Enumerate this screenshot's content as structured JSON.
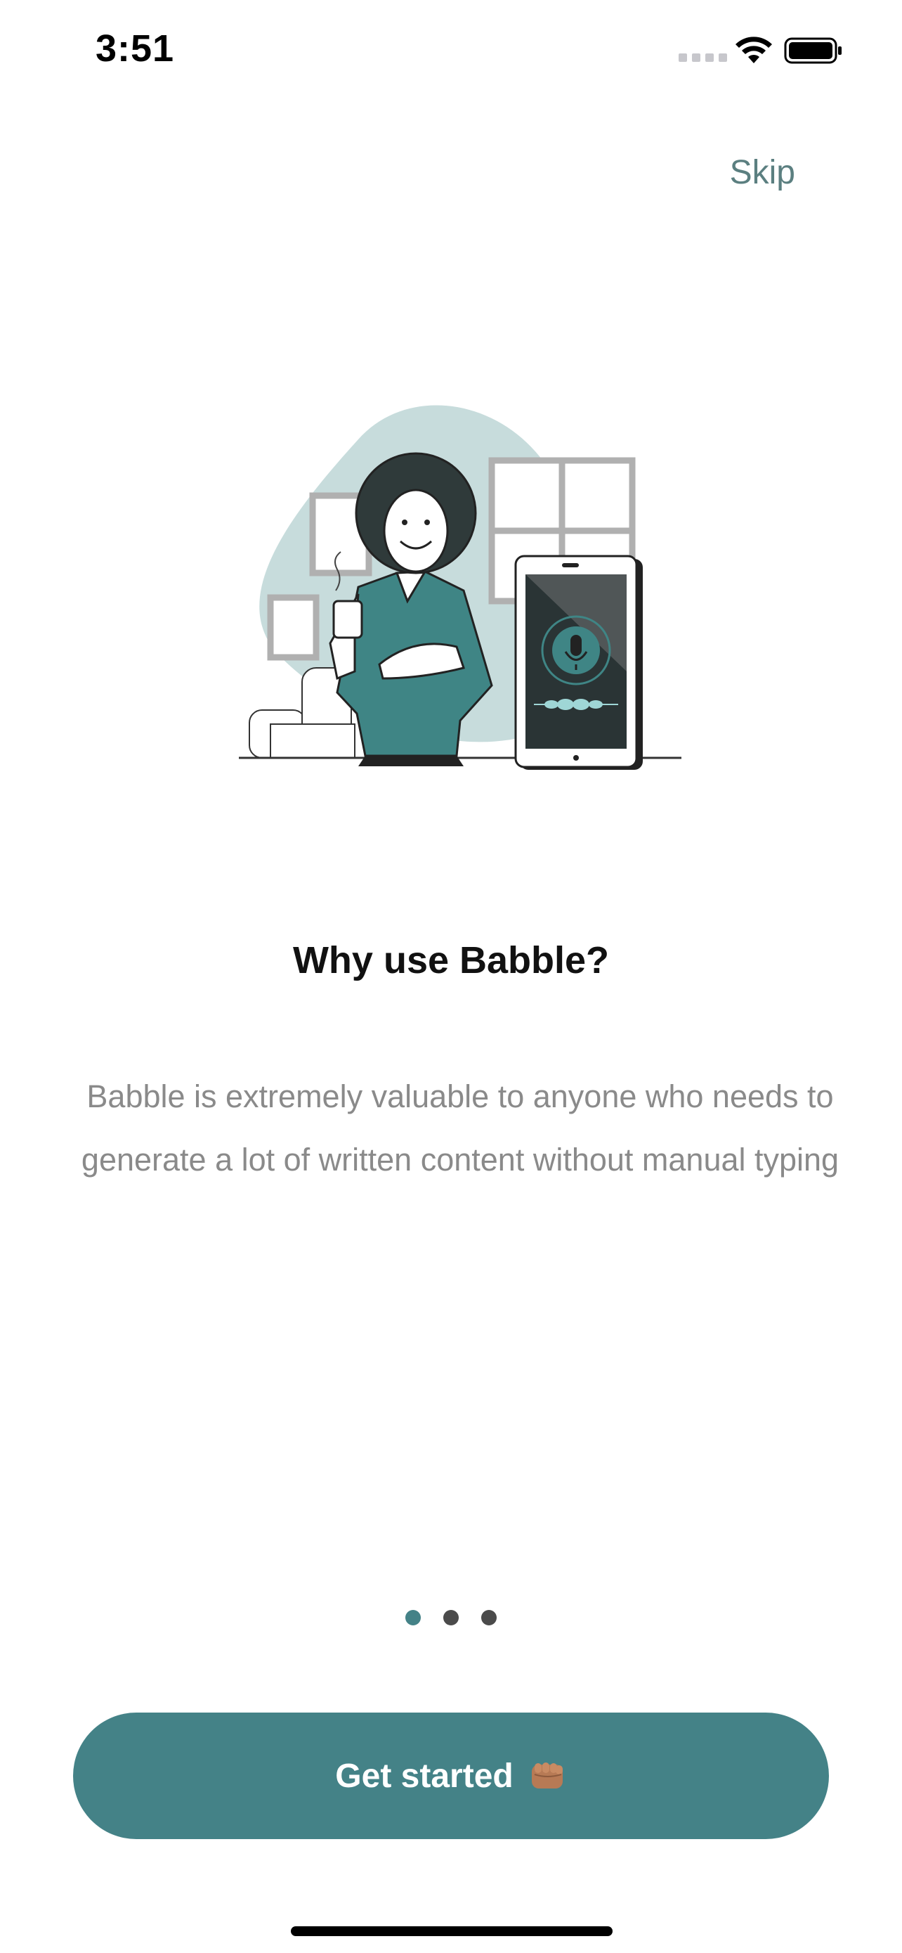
{
  "status_bar": {
    "time": "3:51"
  },
  "header": {
    "skip_label": "Skip"
  },
  "onboarding": {
    "title": "Why use Babble?",
    "description": "Babble is extremely valuable to anyone who needs to generate a lot of written content without manual typing",
    "page_count": 3,
    "current_page": 1
  },
  "cta": {
    "label": "Get started",
    "icon": "fist-bump-icon"
  },
  "colors": {
    "accent": "#448287",
    "skip_text": "#5b7f80",
    "body_text": "#8a8a8a",
    "inactive_dot": "#4b4b4b"
  },
  "illustration": {
    "icon": "woman-with-coffee-and-voice-phone-illustration"
  }
}
